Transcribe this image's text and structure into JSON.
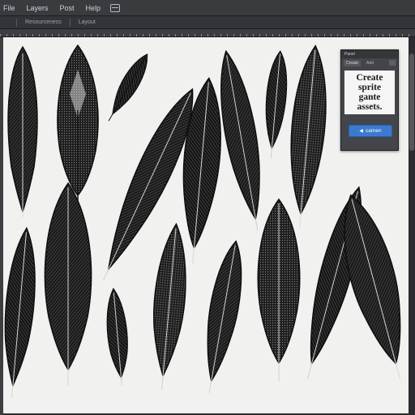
{
  "menubar": {
    "items": [
      "File",
      "Layers",
      "Post",
      "Help"
    ],
    "window_icon": "window-icon"
  },
  "options_bar": {
    "items": [
      "",
      "Resourceness",
      "Layout"
    ]
  },
  "panel": {
    "title": "Panel",
    "tab_active": "Create",
    "tab_other": "Add",
    "body_text": "Create\nsprite\ngante\nassets.",
    "button_label": "camen",
    "button_icon": "arrow-left-icon"
  },
  "colors": {
    "canvas": "#f1f1ef",
    "feather": "#141414",
    "accent": "#3b7ad0",
    "chrome": "#3a3b3f"
  }
}
